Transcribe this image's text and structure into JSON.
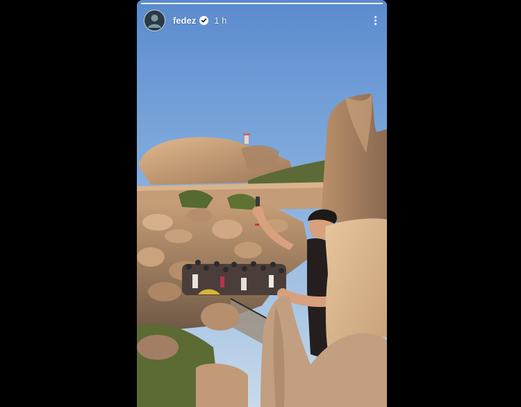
{
  "story": {
    "username": "fedez",
    "timestamp": "1 h",
    "verified": true,
    "progress": 1.0,
    "icons": {
      "avatar": "profile-avatar",
      "verified": "verified-badge-icon",
      "more": "more-vertical-icon"
    }
  },
  "colors": {
    "sky_top": "#5f8fd0",
    "sky_bottom": "#b9d2ea",
    "rock": "#c79e76",
    "text": "#ffffff"
  }
}
